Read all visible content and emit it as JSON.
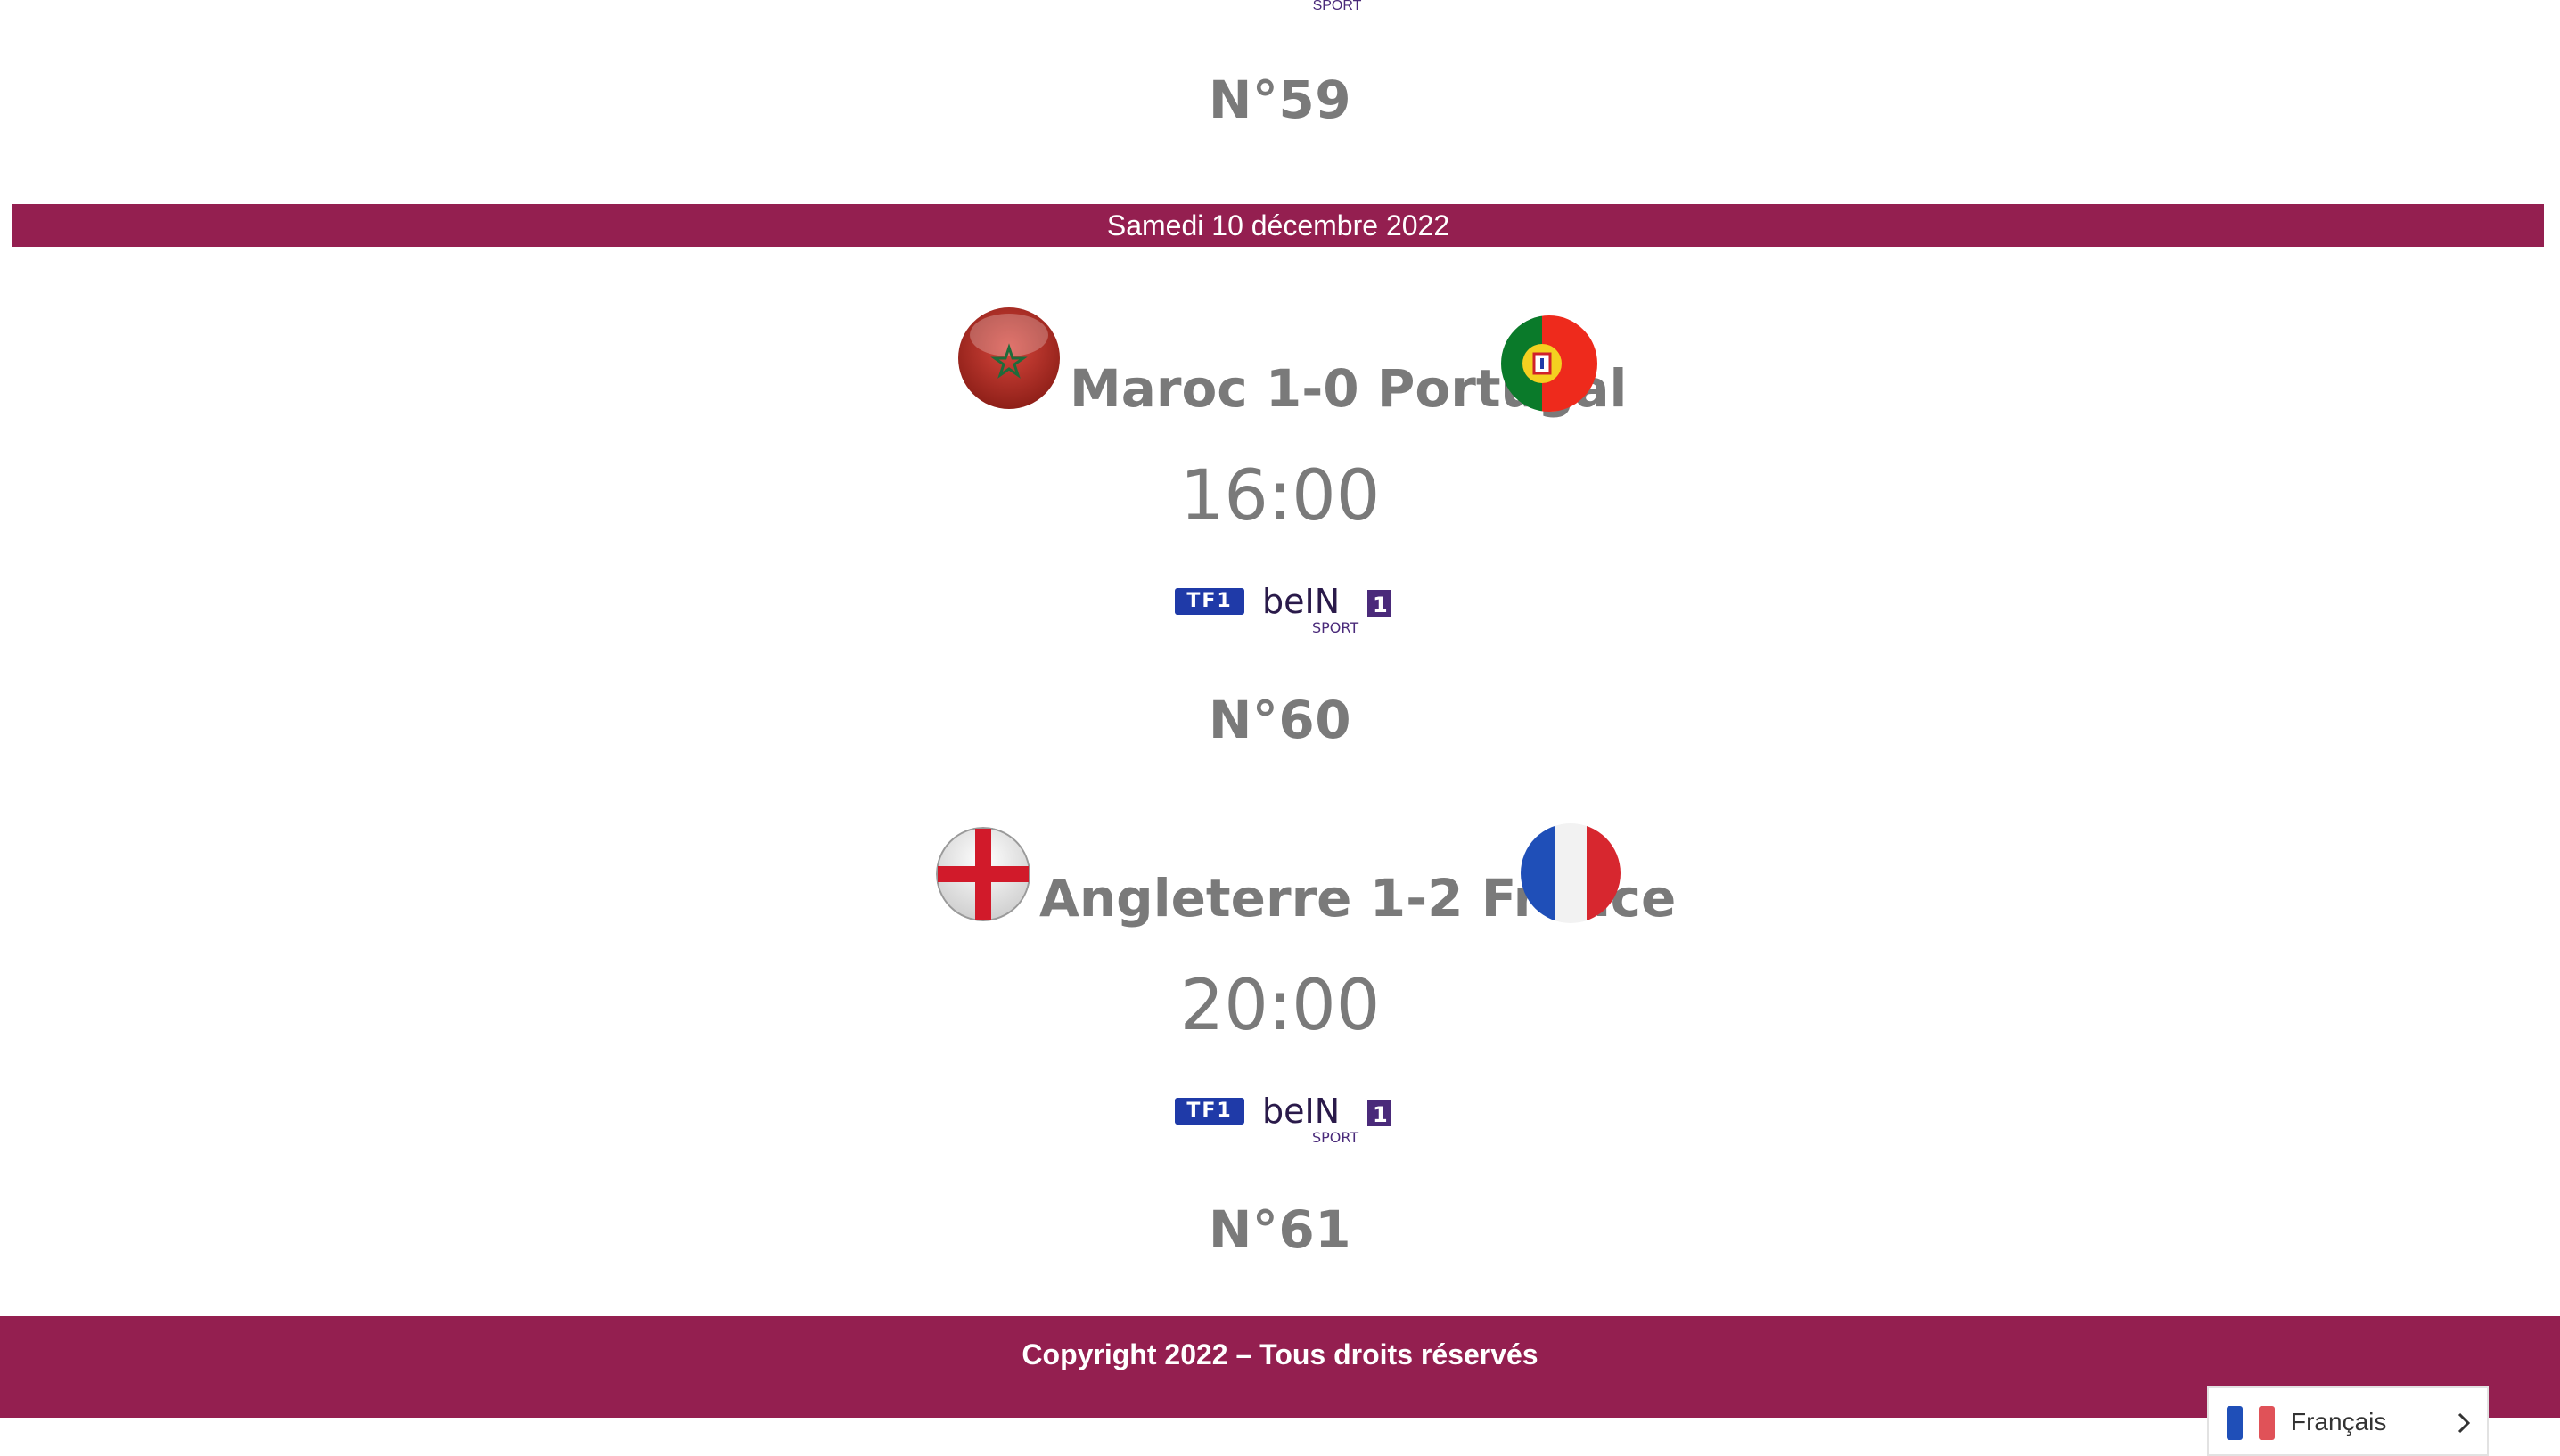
{
  "top_partial": {
    "logo_text": "SPORT",
    "match_number": "N°59"
  },
  "date_header": "Samedi 10 décembre 2022",
  "matches": [
    {
      "home": "Maroc",
      "score": "1-0",
      "away": "Portugal",
      "title": "Maroc 1-0 Portugal",
      "time": "16:00",
      "channels": [
        "TF1",
        "beIN SPORT 1"
      ],
      "match_number": "N°60"
    },
    {
      "home": "Angleterre",
      "score": "1-2",
      "away": "France",
      "title": "Angleterre 1-2 France",
      "time": "20:00",
      "channels": [
        "TF1",
        "beIN SPORT 1"
      ],
      "match_number": "N°61"
    }
  ],
  "footer": {
    "copyright": "Copyright 2022 – Tous droits réservés"
  },
  "language_selector": {
    "label": "Français",
    "icon": "france-flag-icon",
    "arrow": "chevron-right-icon"
  },
  "colors": {
    "brand": "#941f50",
    "text": "#7a7a7a"
  },
  "logos": {
    "tf1_text": "TF1",
    "bein_text": "beIN",
    "bein_number": "1",
    "bein_sub": "SPORT"
  }
}
